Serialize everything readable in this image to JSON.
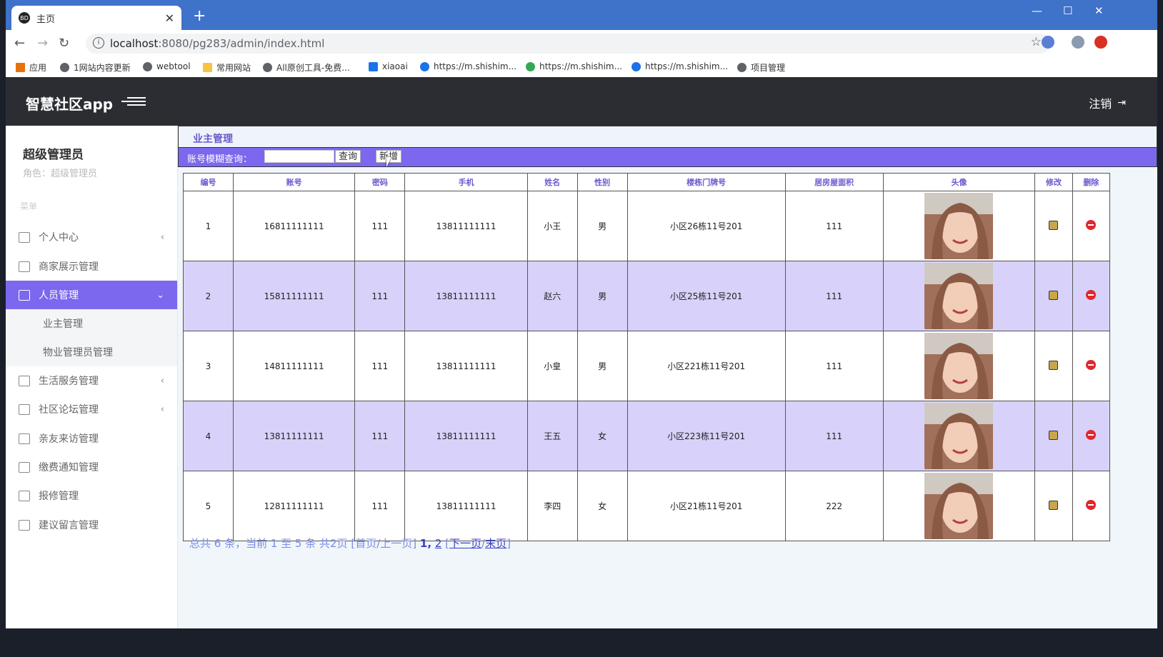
{
  "browser": {
    "tab_title": "主页",
    "favicon_text": "BD",
    "url_host": "localhost",
    "url_path": ":8080/pg283/admin/index.html",
    "bookmarks": [
      "应用",
      "1网站内容更新",
      "webtool",
      "常用网站",
      "All原创工具-免费...",
      "xiaoai",
      "https://m.shishim...",
      "https://m.shishim...",
      "https://m.shishim...",
      "项目管理"
    ]
  },
  "header": {
    "logo": "智慧社区app",
    "logout": "注销"
  },
  "sidebar": {
    "user_name": "超级管理员",
    "role_label": "角色：超级管理员",
    "menu_label": "菜单",
    "items": [
      {
        "label": "个人中心"
      },
      {
        "label": "商家展示管理"
      },
      {
        "label": "人员管理"
      },
      {
        "label": "业主管理"
      },
      {
        "label": "物业管理员管理"
      },
      {
        "label": "生活服务管理"
      },
      {
        "label": "社区论坛管理"
      },
      {
        "label": "亲友来访管理"
      },
      {
        "label": "缴费通知管理"
      },
      {
        "label": "报修管理"
      },
      {
        "label": "建议留言管理"
      }
    ]
  },
  "main": {
    "title": "业主管理",
    "search_label": "账号模糊查询：",
    "search_value": "",
    "query_button": "查询",
    "add_button": "新增",
    "columns": [
      "编号",
      "账号",
      "密码",
      "手机",
      "姓名",
      "性别",
      "楼栋门牌号",
      "居房屋面积",
      "头像",
      "修改",
      "删除"
    ],
    "rows": [
      [
        "1",
        "16811111111",
        "111",
        "13811111111",
        "小王",
        "男",
        "小区26栋11号201",
        "111"
      ],
      [
        "2",
        "15811111111",
        "111",
        "13811111111",
        "赵六",
        "男",
        "小区25栋11号201",
        "111"
      ],
      [
        "3",
        "14811111111",
        "111",
        "13811111111",
        "小皇",
        "男",
        "小区221栋11号201",
        "111"
      ],
      [
        "4",
        "13811111111",
        "111",
        "13811111111",
        "王五",
        "女",
        "小区223栋11号201",
        "111"
      ],
      [
        "5",
        "12811111111",
        "111",
        "13811111111",
        "李四",
        "女",
        "小区21栋11号201",
        "222"
      ]
    ],
    "pager": {
      "summary": "总共 6 条，当前 1 至 5 条 共2页",
      "first_prev": "[首页/上一页]",
      "current_page": "1,",
      "page2": "2",
      "next": "下一页",
      "last": "末页"
    }
  },
  "colors": {
    "accent": "#7b68ee",
    "header_bg": "#2b2d33",
    "alt_row": "#d8d2fa",
    "browser_blue": "#3f72c9"
  }
}
